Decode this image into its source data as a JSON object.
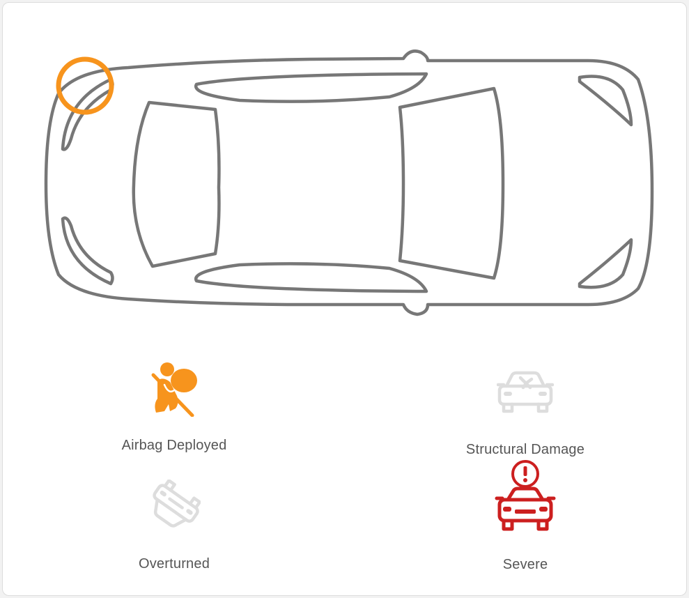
{
  "impact_marker": {
    "location": "front-left corner",
    "color": "#f7941d"
  },
  "colors": {
    "outline": "#777777",
    "active": "#f7941d",
    "inactive": "#dddddd",
    "severe": "#cc1f1f",
    "label": "#555555"
  },
  "indicators": [
    {
      "label": "Airbag Deployed",
      "icon": "airbag-icon",
      "state": "active"
    },
    {
      "label": "Structural Damage",
      "icon": "broken-windshield-car-icon",
      "state": "inactive"
    },
    {
      "label": "Overturned",
      "icon": "overturned-car-icon",
      "state": "inactive"
    },
    {
      "label": "Severe",
      "icon": "car-alert-icon",
      "state": "severe"
    }
  ]
}
